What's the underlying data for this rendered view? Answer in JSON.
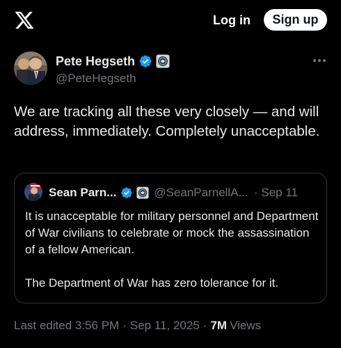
{
  "header": {
    "logo_icon": "x-logo-icon",
    "login_label": "Log in",
    "signup_label": "Sign up"
  },
  "post": {
    "author": {
      "name": "Pete Hegseth",
      "handle": "@PeteHegseth",
      "verified_icon": "verified-badge-icon",
      "affiliation_icon": "government-seal-icon"
    },
    "more_icon": "more-horizontal-icon",
    "text": "We are tracking all these very closely — and will address, immediately. Completely unacceptable.",
    "quoted": {
      "name": "Sean Parn...",
      "handle": "@SeanParnellA...",
      "date": "Sep 11",
      "dot": "·",
      "verified_icon": "verified-badge-icon",
      "affiliation_icon": "government-seal-icon",
      "paragraph1": "It is unacceptable for military personnel and Department of War civilians to celebrate or mock the assassination of a fellow American.",
      "paragraph2": "The Department of War has zero tolerance for it."
    },
    "meta": {
      "edited": "Last edited 3:56 PM",
      "date": "Sep 11, 2025",
      "sep": "·",
      "views_count": "7M",
      "views_label": "Views"
    }
  },
  "colors": {
    "background": "#000000",
    "text_primary": "#e7e9ea",
    "text_secondary": "#71767b",
    "border": "#2f3336",
    "verified_blue": "#1d9bf0"
  }
}
